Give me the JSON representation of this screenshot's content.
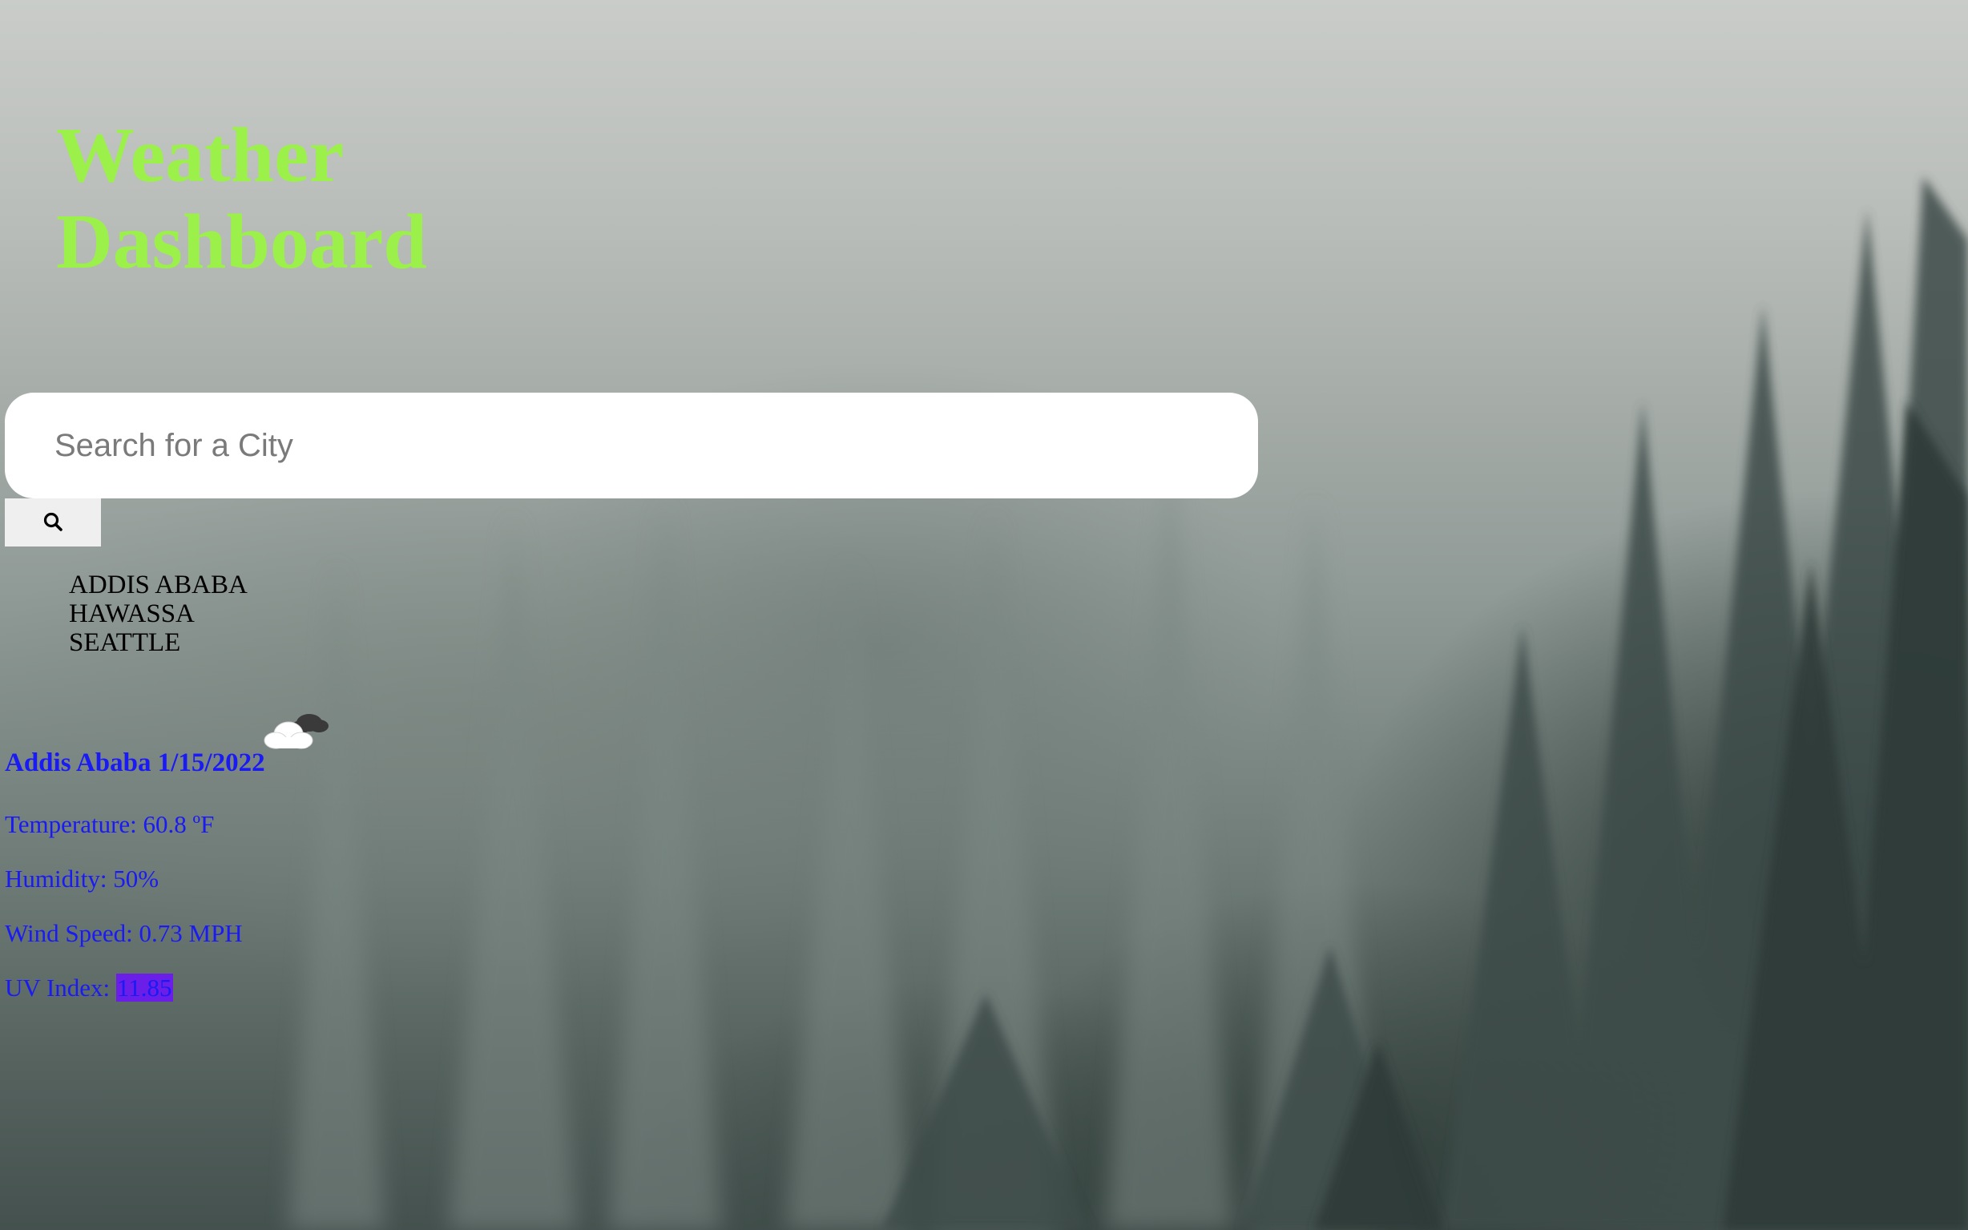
{
  "header": {
    "title_line1": "Weather",
    "title_line2": "Dashboard",
    "title_color": "#9bf04a"
  },
  "search": {
    "placeholder": "Search for a City",
    "value": "",
    "button_icon": "search-icon"
  },
  "history": {
    "items": [
      "ADDIS ABABA",
      "HAWASSA",
      "SEATTLE"
    ]
  },
  "current": {
    "city": "Addis Ababa",
    "date": "1/15/2022",
    "heading": "Addis Ababa 1/15/2022",
    "icon": "cloud-icon",
    "temperature": "Temperature: 60.8 ºF",
    "humidity": "Humidity: 50%",
    "wind": "Wind Speed: 0.73 MPH",
    "uv_label": "UV Index: ",
    "uv_value": "11.85",
    "text_color": "#1a1af5",
    "uv_badge_color": "#6a1ee8"
  }
}
